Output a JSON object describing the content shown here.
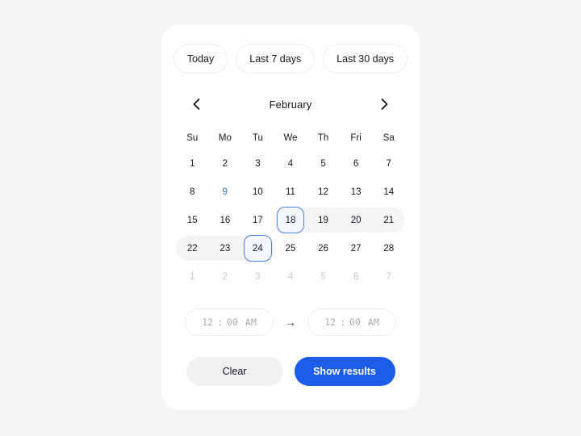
{
  "theme": {
    "page_background": "#f4f5f6",
    "card_background": "#ffffff",
    "accent": "#1d5ce8",
    "today_color": "#2f6fe4",
    "range_band": "#f4f5f6",
    "selected_border": "#4a7fe8",
    "selected_fill": "#f3f7ff",
    "muted_text": "#c4c7cc"
  },
  "quick_filters": [
    {
      "label": "Today"
    },
    {
      "label": "Last 7 days"
    },
    {
      "label": "Last 30 days"
    }
  ],
  "calendar": {
    "month_label": "February",
    "prev_icon": "chevron-left-icon",
    "next_icon": "chevron-right-icon",
    "weekdays": [
      "Su",
      "Mo",
      "Tu",
      "We",
      "Th",
      "Fri",
      "Sa"
    ],
    "weeks": [
      [
        {
          "day": "1",
          "state": "normal"
        },
        {
          "day": "2",
          "state": "normal"
        },
        {
          "day": "3",
          "state": "normal"
        },
        {
          "day": "4",
          "state": "normal"
        },
        {
          "day": "5",
          "state": "normal"
        },
        {
          "day": "6",
          "state": "normal"
        },
        {
          "day": "7",
          "state": "normal"
        }
      ],
      [
        {
          "day": "8",
          "state": "normal"
        },
        {
          "day": "9",
          "state": "today"
        },
        {
          "day": "10",
          "state": "normal"
        },
        {
          "day": "11",
          "state": "normal"
        },
        {
          "day": "12",
          "state": "normal"
        },
        {
          "day": "13",
          "state": "normal"
        },
        {
          "day": "14",
          "state": "normal"
        }
      ],
      [
        {
          "day": "15",
          "state": "normal"
        },
        {
          "day": "16",
          "state": "normal"
        },
        {
          "day": "17",
          "state": "normal"
        },
        {
          "day": "18",
          "state": "range-start"
        },
        {
          "day": "19",
          "state": "in-range"
        },
        {
          "day": "20",
          "state": "in-range"
        },
        {
          "day": "21",
          "state": "in-range"
        }
      ],
      [
        {
          "day": "22",
          "state": "in-range"
        },
        {
          "day": "23",
          "state": "in-range"
        },
        {
          "day": "24",
          "state": "range-end"
        },
        {
          "day": "25",
          "state": "normal"
        },
        {
          "day": "26",
          "state": "normal"
        },
        {
          "day": "27",
          "state": "normal"
        },
        {
          "day": "28",
          "state": "normal"
        }
      ],
      [
        {
          "day": "1",
          "state": "outside"
        },
        {
          "day": "2",
          "state": "outside"
        },
        {
          "day": "3",
          "state": "outside"
        },
        {
          "day": "4",
          "state": "outside"
        },
        {
          "day": "5",
          "state": "outside"
        },
        {
          "day": "6",
          "state": "outside"
        },
        {
          "day": "7",
          "state": "outside"
        }
      ]
    ],
    "bands": [
      {
        "week": 2,
        "start": 3,
        "end": 6,
        "left_round": true,
        "right_round": true
      },
      {
        "week": 3,
        "start": 0,
        "end": 2,
        "left_round": true,
        "right_round": true
      }
    ]
  },
  "time": {
    "start": {
      "hour": "12",
      "separator": ":",
      "minute": "00",
      "meridiem": "AM"
    },
    "end": {
      "hour": "12",
      "separator": ":",
      "minute": "00",
      "meridiem": "AM"
    },
    "arrow_icon": "arrow-right-icon",
    "arrow_glyph": "→"
  },
  "actions": {
    "clear_label": "Clear",
    "submit_label": "Show results"
  }
}
